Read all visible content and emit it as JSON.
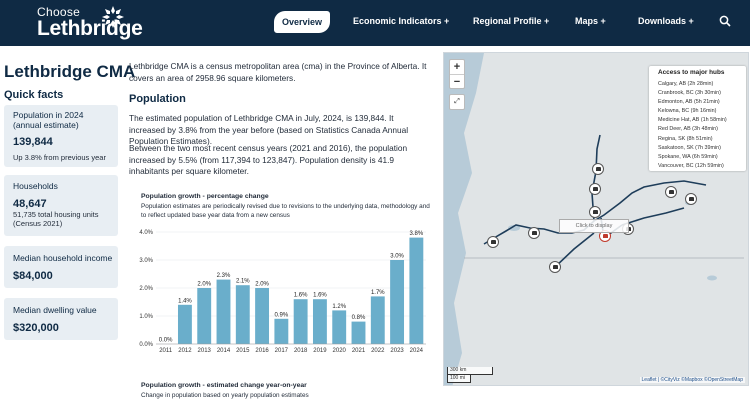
{
  "header": {
    "logo_line1": "Choose",
    "logo_line2": "Lethbridge",
    "nav": {
      "overview": "Overview",
      "economic": "Economic Indicators +",
      "regional": "Regional Profile +",
      "maps": "Maps +",
      "downloads": "Downloads +"
    },
    "search_icon": "search-icon"
  },
  "sidebar": {
    "title": "Lethbridge CMA",
    "quick_facts": "Quick facts",
    "cards": [
      {
        "label": "Population in 2024 (annual estimate)",
        "value": "139,844",
        "sub": "Up 3.8% from previous year"
      },
      {
        "label": "Households",
        "value": "48,647",
        "sub": "51,735 total housing units (Census 2021)"
      },
      {
        "label": "Median household income",
        "value": "$84,000"
      },
      {
        "label": "Median dwelling value",
        "value": "$320,000"
      }
    ]
  },
  "main": {
    "intro": "Lethbridge CMA is a census metropolitan area (cma) in the Province of Alberta. It covers an area of 2958.96 square kilometers.",
    "population_heading": "Population",
    "para1": "The estimated population of Lethbridge CMA in July, 2024, is 139,844. It increased by 3.8% from the year before (based on Statistics Canada Annual Population Estimates).",
    "para2": "Between the two most recent census years (2021 and 2016), the population increased by 5.5% (from 117,394 to 123,847). Population density is 41.9 inhabitants per square kilometer.",
    "chart1_title": "Population growth - percentage change",
    "chart1_sub": "Population estimates are periodically revised due to revisions to the underlying data, methodology and to reflect updated base year data from a new census",
    "chart2_title": "Population growth - estimated change year-on-year",
    "chart2_sub": "Change in population based on yearly population estimates"
  },
  "chart_data": {
    "type": "bar",
    "categories": [
      "2011",
      "2012",
      "2013",
      "2014",
      "2015",
      "2016",
      "2017",
      "2018",
      "2019",
      "2020",
      "2021",
      "2022",
      "2023",
      "2024"
    ],
    "values": [
      0.0,
      1.4,
      2.0,
      2.3,
      2.1,
      2.0,
      0.9,
      1.6,
      1.6,
      1.2,
      0.8,
      1.7,
      3.0,
      3.8
    ],
    "data_labels": [
      "0.0%",
      "1.4%",
      "2.0%",
      "2.3%",
      "2.1%",
      "2.0%",
      "0.9%",
      "1.6%",
      "1.6%",
      "1.2%",
      "0.8%",
      "1.7%",
      "3.0%",
      "3.8%"
    ],
    "yticks": [
      "0.0%",
      "1.0%",
      "2.0%",
      "3.0%",
      "4.0%"
    ],
    "ylim": [
      0,
      4
    ],
    "color": "#6aaecb",
    "grid": true
  },
  "map": {
    "zoom_in": "+",
    "zoom_out": "−",
    "fullscreen": "⤢",
    "hubs_title": "Access to major hubs",
    "hubs": [
      "Calgary, AB (2h 28min)",
      "Cranbrook, BC (3h 30min)",
      "Edmonton, AB (5h 21min)",
      "Kelowna, BC (9h 16min)",
      "Medicine Hat, AB (1h 58min)",
      "Red Deer, AB (3h 48min)",
      "Regina, SK (8h 51min)",
      "Saskatoon, SK (7h 39min)",
      "Spokane, WA (6h 59min)",
      "Vancouver, BC (12h 59min)"
    ],
    "click_tip": "Click to display",
    "scale_km": "300 km",
    "scale_mi": "100 mi",
    "attribution": "Leaflet | ©CityViz ©Mapbox ©OpenStreetMap"
  }
}
